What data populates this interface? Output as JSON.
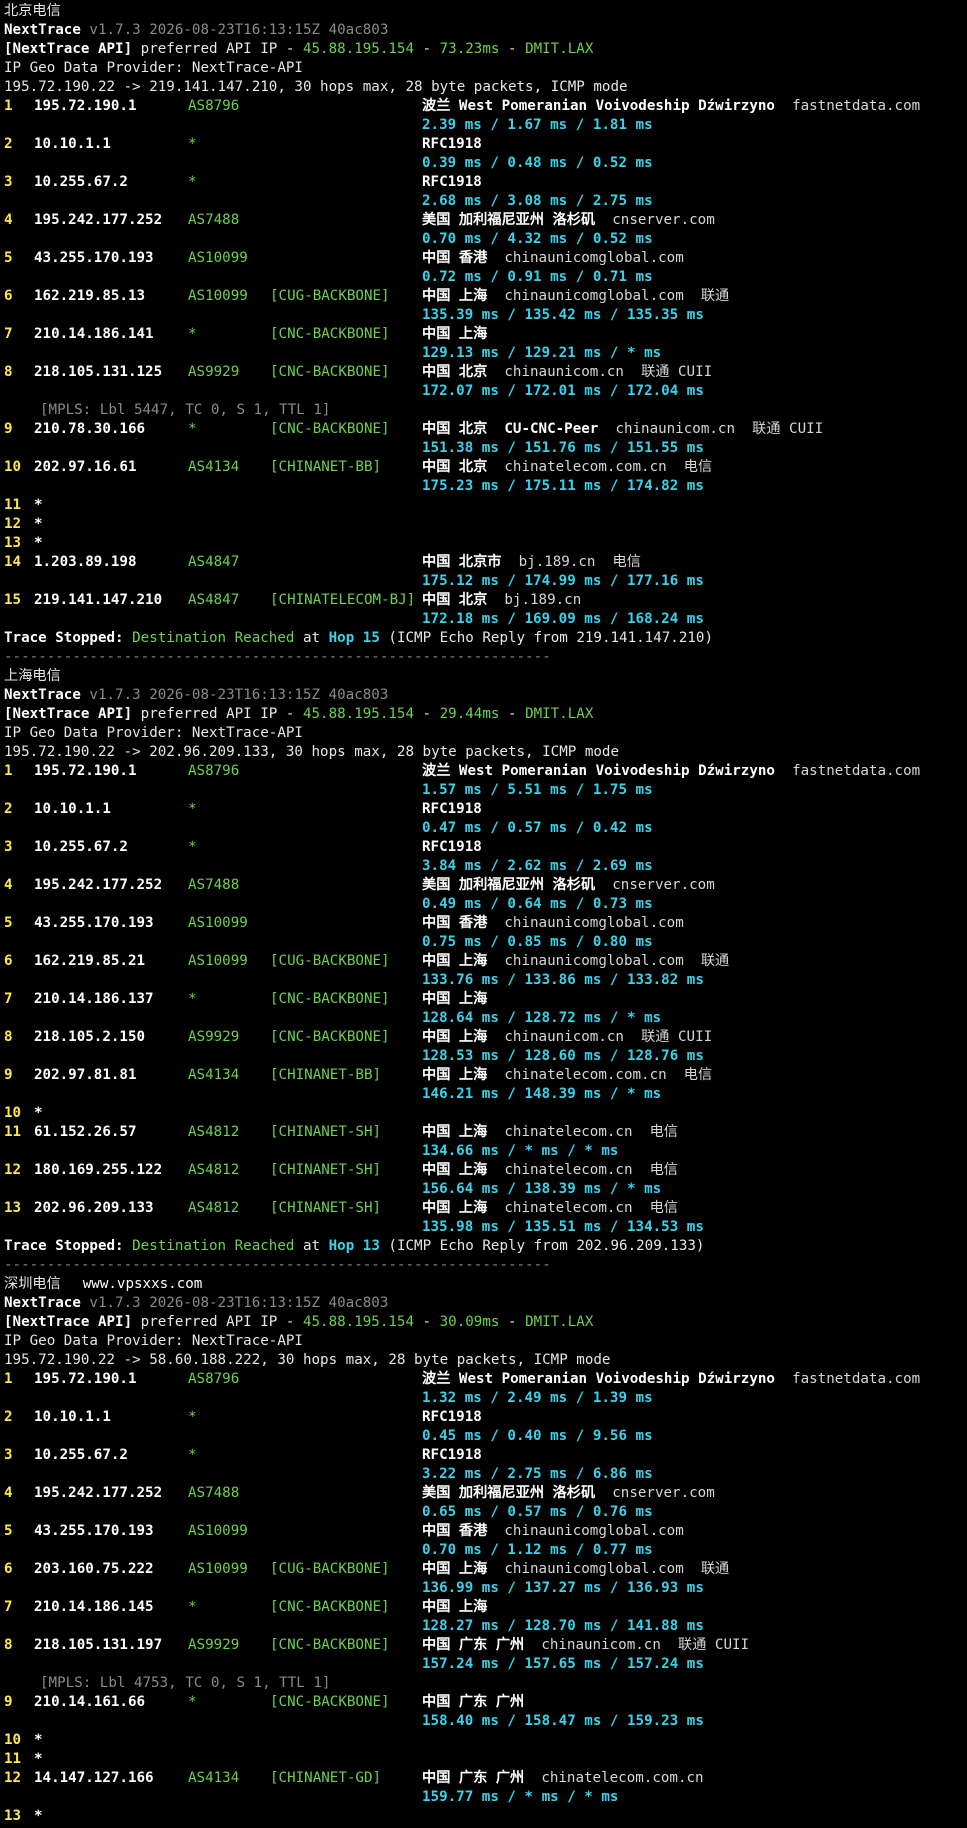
{
  "theme": {
    "background": "#000000",
    "green": "#6bd14f",
    "yellow": "#ffe84a",
    "cyan": "#3ad2ea"
  },
  "watermark": "www.vpsxxs.com",
  "separator": "----------------------------------------------------------------",
  "sections": [
    {
      "title": "北京电信",
      "version_line": "v1.7.3 2026-08-23T16:13:15Z 40ac803",
      "api_prefix": "[NextTrace API]",
      "api_text": " preferred API IP - ",
      "api_ip": "45.88.195.154",
      "api_latency": "73.23ms",
      "api_node": "DMIT.LAX",
      "provider": "IP Geo Data Provider: NextTrace-API",
      "route": "195.72.190.22 -> 219.141.147.210, 30 hops max, 28 byte packets, ICMP mode",
      "hops": [
        {
          "num": "1",
          "ip": "195.72.190.1",
          "asn": "AS8796",
          "tag": "",
          "geo": "波兰 West Pomeranian Voivodeship Dźwirzyno",
          "host": "fastnetdata.com",
          "isp": "",
          "rtt": "2.39 ms / 1.67 ms / 1.81 ms"
        },
        {
          "num": "2",
          "ip": "10.10.1.1",
          "asn": "*",
          "tag": "",
          "geo": "RFC1918",
          "host": "",
          "isp": "",
          "rtt": "0.39 ms / 0.48 ms / 0.52 ms"
        },
        {
          "num": "3",
          "ip": "10.255.67.2",
          "asn": "*",
          "tag": "",
          "geo": "RFC1918",
          "host": "",
          "isp": "",
          "rtt": "2.68 ms / 3.08 ms / 2.75 ms"
        },
        {
          "num": "4",
          "ip": "195.242.177.252",
          "asn": "AS7488",
          "tag": "",
          "geo": "美国 加利福尼亚州 洛杉矶",
          "host": "cnserver.com",
          "isp": "",
          "rtt": "0.70 ms / 4.32 ms / 0.52 ms"
        },
        {
          "num": "5",
          "ip": "43.255.170.193",
          "asn": "AS10099",
          "tag": "",
          "geo": "中国 香港",
          "host": "chinaunicomglobal.com",
          "isp": "",
          "rtt": "0.72 ms / 0.91 ms / 0.71 ms"
        },
        {
          "num": "6",
          "ip": "162.219.85.13",
          "asn": "AS10099",
          "tag": "[CUG-BACKBONE]",
          "geo": "中国 上海",
          "host": "chinaunicomglobal.com",
          "isp": "联通",
          "rtt": "135.39 ms / 135.42 ms / 135.35 ms"
        },
        {
          "num": "7",
          "ip": "210.14.186.141",
          "asn": "*",
          "tag": "[CNC-BACKBONE]",
          "geo": "中国 上海",
          "host": "",
          "isp": "",
          "rtt": "129.13 ms / 129.21 ms / * ms"
        },
        {
          "num": "8",
          "ip": "218.105.131.125",
          "asn": "AS9929",
          "tag": "[CNC-BACKBONE]",
          "geo": "中国 北京",
          "host": "chinaunicom.cn",
          "isp": "联通 CUII",
          "rtt": "172.07 ms / 172.01 ms / 172.04 ms",
          "mpls": "[MPLS: Lbl 5447, TC 0, S 1, TTL 1]"
        },
        {
          "num": "9",
          "ip": "210.78.30.166",
          "asn": "*",
          "tag": "[CNC-BACKBONE]",
          "geo": "中国 北京  CU-CNC-Peer",
          "host": "chinaunicom.cn",
          "isp": "联通 CUII",
          "rtt": "151.38 ms / 151.76 ms / 151.55 ms"
        },
        {
          "num": "10",
          "ip": "202.97.16.61",
          "asn": "AS4134",
          "tag": "[CHINANET-BB]",
          "geo": "中国 北京",
          "host": "chinatelecom.com.cn",
          "isp": "电信",
          "rtt": "175.23 ms / 175.11 ms / 174.82 ms"
        },
        {
          "num": "11",
          "ip": "*"
        },
        {
          "num": "12",
          "ip": "*"
        },
        {
          "num": "13",
          "ip": "*"
        },
        {
          "num": "14",
          "ip": "1.203.89.198",
          "asn": "AS4847",
          "tag": "",
          "geo": "中国 北京市",
          "host": "bj.189.cn",
          "isp": "电信",
          "rtt": "175.12 ms / 174.99 ms / 177.16 ms"
        },
        {
          "num": "15",
          "ip": "219.141.147.210",
          "asn": "AS4847",
          "tag": "[CHINATELECOM-BJ]",
          "geo": "中国 北京",
          "host": "bj.189.cn",
          "isp": "",
          "rtt": "172.18 ms / 169.09 ms / 168.24 ms"
        }
      ],
      "stop": {
        "label": "Trace Stopped:",
        "reached": "Destination Reached",
        "at": "at",
        "hop": "Hop 15",
        "tail": "(ICMP Echo Reply from 219.141.147.210)"
      }
    },
    {
      "title": "上海电信",
      "version_line": "v1.7.3 2026-08-23T16:13:15Z 40ac803",
      "api_prefix": "[NextTrace API]",
      "api_text": " preferred API IP - ",
      "api_ip": "45.88.195.154",
      "api_latency": "29.44ms",
      "api_node": "DMIT.LAX",
      "provider": "IP Geo Data Provider: NextTrace-API",
      "route": "195.72.190.22 -> 202.96.209.133, 30 hops max, 28 byte packets, ICMP mode",
      "hops": [
        {
          "num": "1",
          "ip": "195.72.190.1",
          "asn": "AS8796",
          "tag": "",
          "geo": "波兰 West Pomeranian Voivodeship Dźwirzyno",
          "host": "fastnetdata.com",
          "isp": "",
          "rtt": "1.57 ms / 5.51 ms / 1.75 ms"
        },
        {
          "num": "2",
          "ip": "10.10.1.1",
          "asn": "*",
          "tag": "",
          "geo": "RFC1918",
          "host": "",
          "isp": "",
          "rtt": "0.47 ms / 0.57 ms / 0.42 ms"
        },
        {
          "num": "3",
          "ip": "10.255.67.2",
          "asn": "*",
          "tag": "",
          "geo": "RFC1918",
          "host": "",
          "isp": "",
          "rtt": "3.84 ms / 2.62 ms / 2.69 ms"
        },
        {
          "num": "4",
          "ip": "195.242.177.252",
          "asn": "AS7488",
          "tag": "",
          "geo": "美国 加利福尼亚州 洛杉矶",
          "host": "cnserver.com",
          "isp": "",
          "rtt": "0.49 ms / 0.64 ms / 0.73 ms"
        },
        {
          "num": "5",
          "ip": "43.255.170.193",
          "asn": "AS10099",
          "tag": "",
          "geo": "中国 香港",
          "host": "chinaunicomglobal.com",
          "isp": "",
          "rtt": "0.75 ms / 0.85 ms / 0.80 ms"
        },
        {
          "num": "6",
          "ip": "162.219.85.21",
          "asn": "AS10099",
          "tag": "[CUG-BACKBONE]",
          "geo": "中国 上海",
          "host": "chinaunicomglobal.com",
          "isp": "联通",
          "rtt": "133.76 ms / 133.86 ms / 133.82 ms"
        },
        {
          "num": "7",
          "ip": "210.14.186.137",
          "asn": "*",
          "tag": "[CNC-BACKBONE]",
          "geo": "中国 上海",
          "host": "",
          "isp": "",
          "rtt": "128.64 ms / 128.72 ms / * ms"
        },
        {
          "num": "8",
          "ip": "218.105.2.150",
          "asn": "AS9929",
          "tag": "[CNC-BACKBONE]",
          "geo": "中国 上海",
          "host": "chinaunicom.cn",
          "isp": "联通 CUII",
          "rtt": "128.53 ms / 128.60 ms / 128.76 ms"
        },
        {
          "num": "9",
          "ip": "202.97.81.81",
          "asn": "AS4134",
          "tag": "[CHINANET-BB]",
          "geo": "中国 上海",
          "host": "chinatelecom.com.cn",
          "isp": "电信",
          "rtt": "146.21 ms / 148.39 ms / * ms"
        },
        {
          "num": "10",
          "ip": "*"
        },
        {
          "num": "11",
          "ip": "61.152.26.57",
          "asn": "AS4812",
          "tag": "[CHINANET-SH]",
          "geo": "中国 上海",
          "host": "chinatelecom.cn",
          "isp": "电信",
          "rtt": "134.66 ms / * ms / * ms"
        },
        {
          "num": "12",
          "ip": "180.169.255.122",
          "asn": "AS4812",
          "tag": "[CHINANET-SH]",
          "geo": "中国 上海",
          "host": "chinatelecom.cn",
          "isp": "电信",
          "rtt": "156.64 ms / 138.39 ms / * ms"
        },
        {
          "num": "13",
          "ip": "202.96.209.133",
          "asn": "AS4812",
          "tag": "[CHINANET-SH]",
          "geo": "中国 上海",
          "host": "chinatelecom.cn",
          "isp": "电信",
          "rtt": "135.98 ms / 135.51 ms / 134.53 ms"
        }
      ],
      "stop": {
        "label": "Trace Stopped:",
        "reached": "Destination Reached",
        "at": "at",
        "hop": "Hop 13",
        "tail": "(ICMP Echo Reply from 202.96.209.133)"
      }
    },
    {
      "title": "深圳电信",
      "version_line": "v1.7.3 2026-08-23T16:13:15Z 40ac803",
      "api_prefix": "[NextTrace API]",
      "api_text": " preferred API IP - ",
      "api_ip": "45.88.195.154",
      "api_latency": "30.09ms",
      "api_node": "DMIT.LAX",
      "provider": "IP Geo Data Provider: NextTrace-API",
      "route": "195.72.190.22 -> 58.60.188.222, 30 hops max, 28 byte packets, ICMP mode",
      "hops": [
        {
          "num": "1",
          "ip": "195.72.190.1",
          "asn": "AS8796",
          "tag": "",
          "geo": "波兰 West Pomeranian Voivodeship Dźwirzyno",
          "host": "fastnetdata.com",
          "isp": "",
          "rtt": "1.32 ms / 2.49 ms / 1.39 ms"
        },
        {
          "num": "2",
          "ip": "10.10.1.1",
          "asn": "*",
          "tag": "",
          "geo": "RFC1918",
          "host": "",
          "isp": "",
          "rtt": "0.45 ms / 0.40 ms / 9.56 ms"
        },
        {
          "num": "3",
          "ip": "10.255.67.2",
          "asn": "*",
          "tag": "",
          "geo": "RFC1918",
          "host": "",
          "isp": "",
          "rtt": "3.22 ms / 2.75 ms / 6.86 ms"
        },
        {
          "num": "4",
          "ip": "195.242.177.252",
          "asn": "AS7488",
          "tag": "",
          "geo": "美国 加利福尼亚州 洛杉矶",
          "host": "cnserver.com",
          "isp": "",
          "rtt": "0.65 ms / 0.57 ms / 0.76 ms"
        },
        {
          "num": "5",
          "ip": "43.255.170.193",
          "asn": "AS10099",
          "tag": "",
          "geo": "中国 香港",
          "host": "chinaunicomglobal.com",
          "isp": "",
          "rtt": "0.70 ms / 1.12 ms / 0.77 ms"
        },
        {
          "num": "6",
          "ip": "203.160.75.222",
          "asn": "AS10099",
          "tag": "[CUG-BACKBONE]",
          "geo": "中国 上海",
          "host": "chinaunicomglobal.com",
          "isp": "联通",
          "rtt": "136.99 ms / 137.27 ms / 136.93 ms"
        },
        {
          "num": "7",
          "ip": "210.14.186.145",
          "asn": "*",
          "tag": "[CNC-BACKBONE]",
          "geo": "中国 上海",
          "host": "",
          "isp": "",
          "rtt": "128.27 ms / 128.70 ms / 141.88 ms"
        },
        {
          "num": "8",
          "ip": "218.105.131.197",
          "asn": "AS9929",
          "tag": "[CNC-BACKBONE]",
          "geo": "中国 广东 广州",
          "host": "chinaunicom.cn",
          "isp": "联通 CUII",
          "rtt": "157.24 ms / 157.65 ms / 157.24 ms",
          "mpls": "[MPLS: Lbl 4753, TC 0, S 1, TTL 1]"
        },
        {
          "num": "9",
          "ip": "210.14.161.66",
          "asn": "*",
          "tag": "[CNC-BACKBONE]",
          "geo": "中国 广东 广州",
          "host": "",
          "isp": "",
          "rtt": "158.40 ms / 158.47 ms / 159.23 ms"
        },
        {
          "num": "10",
          "ip": "*"
        },
        {
          "num": "11",
          "ip": "*"
        },
        {
          "num": "12",
          "ip": "14.147.127.166",
          "asn": "AS4134",
          "tag": "[CHINANET-GD]",
          "geo": "中国 广东 广州",
          "host": "chinatelecom.com.cn",
          "isp": "",
          "rtt": "159.77 ms / * ms / * ms"
        },
        {
          "num": "13",
          "ip": "*"
        }
      ]
    }
  ]
}
